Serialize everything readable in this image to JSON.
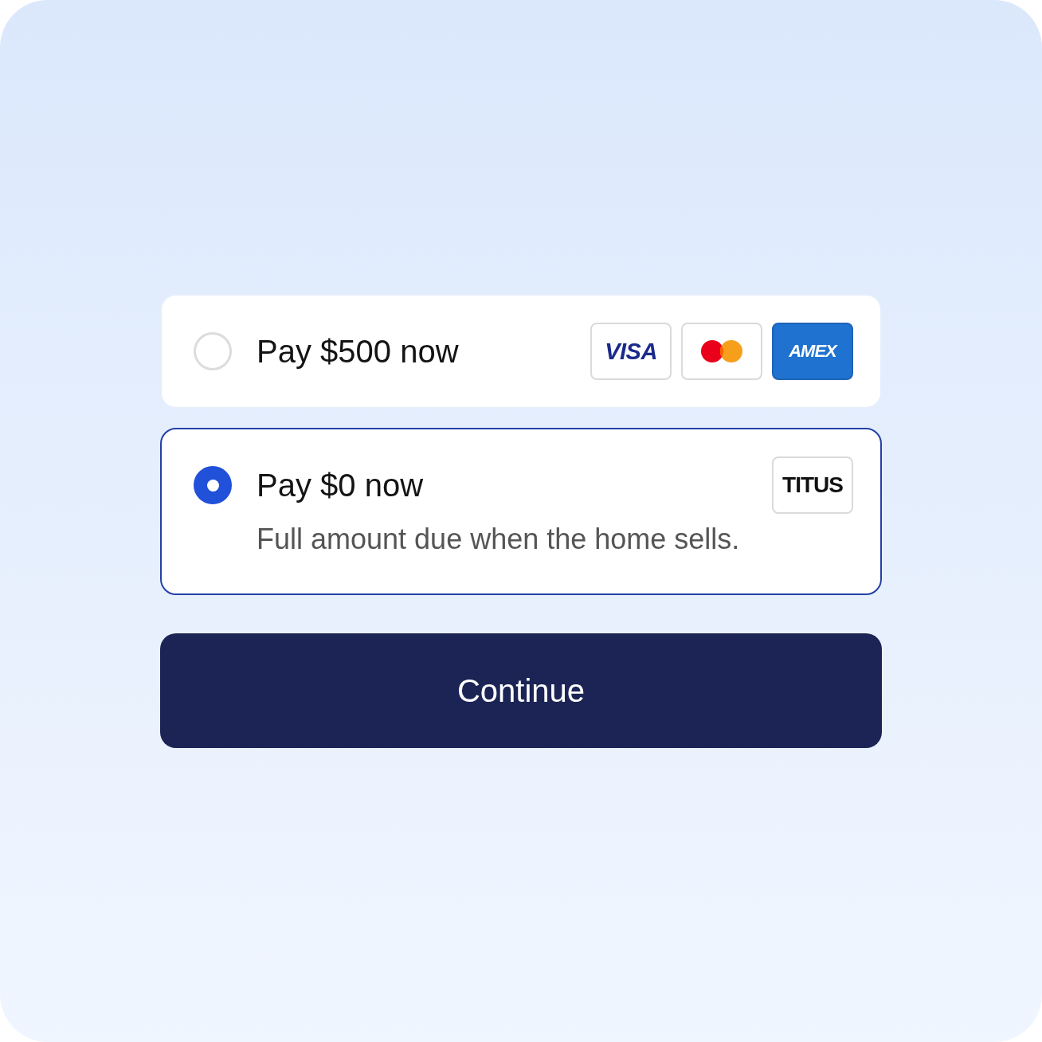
{
  "options": [
    {
      "title": "Pay $500 now",
      "selected": false,
      "logos": [
        {
          "kind": "visa",
          "label": "VISA"
        },
        {
          "kind": "circles"
        },
        {
          "kind": "amex",
          "label": "AMEX"
        }
      ]
    },
    {
      "title": "Pay $0 now",
      "selected": true,
      "description": "Full amount due when the home sells.",
      "logos": [
        {
          "kind": "titus",
          "label": "TITUS"
        }
      ]
    }
  ],
  "button": {
    "label": "Continue"
  }
}
